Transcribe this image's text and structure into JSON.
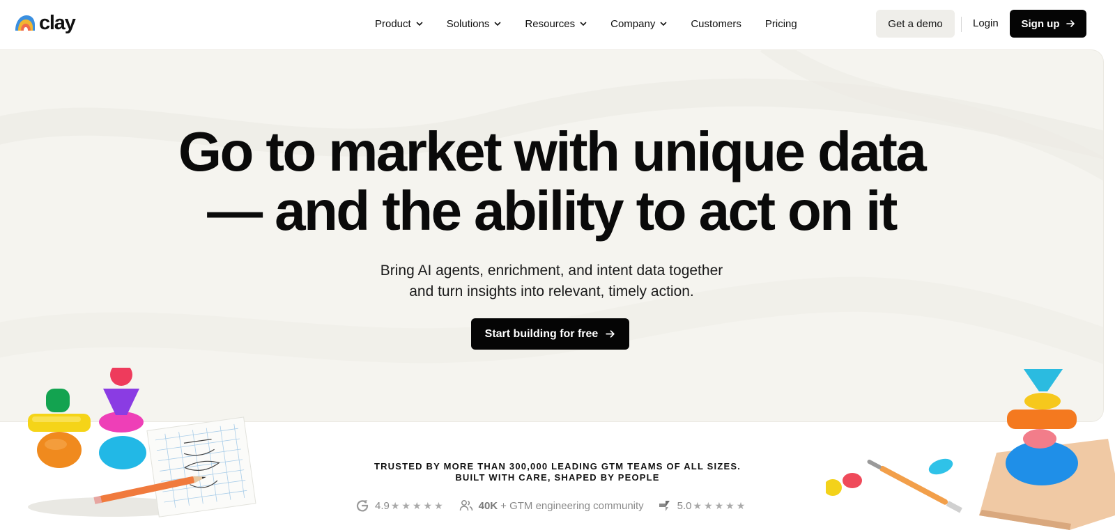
{
  "nav": {
    "logo_text": "clay",
    "links": [
      {
        "label": "Product",
        "dropdown": true
      },
      {
        "label": "Solutions",
        "dropdown": true
      },
      {
        "label": "Resources",
        "dropdown": true
      },
      {
        "label": "Company",
        "dropdown": true
      },
      {
        "label": "Customers",
        "dropdown": false
      },
      {
        "label": "Pricing",
        "dropdown": false
      }
    ],
    "demo_label": "Get a demo",
    "login_label": "Login",
    "signup_label": "Sign up"
  },
  "hero": {
    "title_line1": "Go to market with unique data",
    "title_line2": "— and the ability to act on it",
    "subtitle_line1": "Bring AI agents, enrichment, and intent data together",
    "subtitle_line2": "and turn insights into relevant, timely action.",
    "cta_label": "Start building for free"
  },
  "trust": {
    "line1": "TRUSTED BY MORE THAN 300,000 LEADING GTM TEAMS OF ALL SIZES.",
    "line2": "BUILT WITH CARE, SHAPED BY PEOPLE"
  },
  "stats": {
    "g2_rating": "4.9",
    "stars": "★★★★★",
    "community_count": "40K",
    "community_label": "+ GTM engineering community",
    "capterra_rating": "5.0"
  },
  "colors": {
    "primary_button": "#050505",
    "hero_bg": "#f5f4ef",
    "demo_button_bg": "#efeeea"
  },
  "icons": [
    "arrow-right-icon",
    "chevron-down-icon",
    "g2-icon",
    "users-icon",
    "capterra-icon"
  ]
}
